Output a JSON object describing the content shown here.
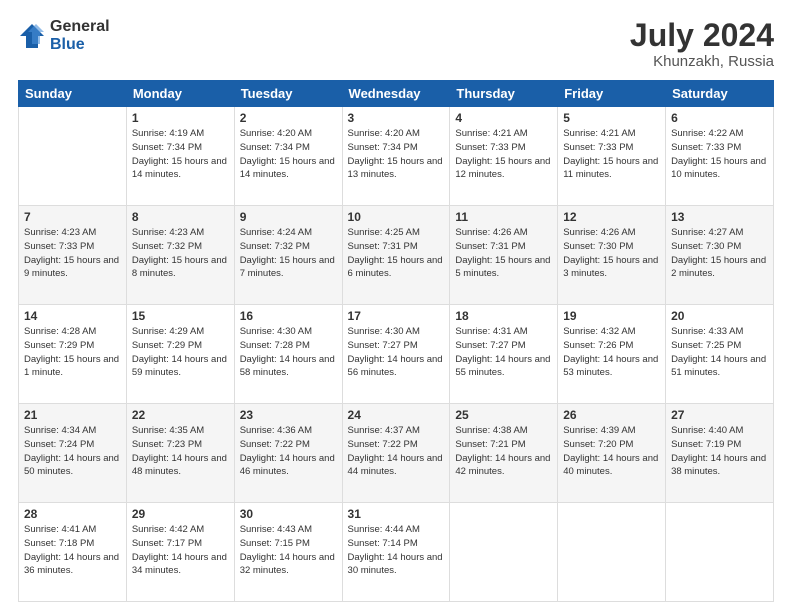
{
  "logo": {
    "general": "General",
    "blue": "Blue"
  },
  "title": {
    "month_year": "July 2024",
    "location": "Khunzakh, Russia"
  },
  "days_of_week": [
    "Sunday",
    "Monday",
    "Tuesday",
    "Wednesday",
    "Thursday",
    "Friday",
    "Saturday"
  ],
  "weeks": [
    [
      {
        "day": "",
        "sunrise": "",
        "sunset": "",
        "daylight": ""
      },
      {
        "day": "1",
        "sunrise": "Sunrise: 4:19 AM",
        "sunset": "Sunset: 7:34 PM",
        "daylight": "Daylight: 15 hours and 14 minutes."
      },
      {
        "day": "2",
        "sunrise": "Sunrise: 4:20 AM",
        "sunset": "Sunset: 7:34 PM",
        "daylight": "Daylight: 15 hours and 14 minutes."
      },
      {
        "day": "3",
        "sunrise": "Sunrise: 4:20 AM",
        "sunset": "Sunset: 7:34 PM",
        "daylight": "Daylight: 15 hours and 13 minutes."
      },
      {
        "day": "4",
        "sunrise": "Sunrise: 4:21 AM",
        "sunset": "Sunset: 7:33 PM",
        "daylight": "Daylight: 15 hours and 12 minutes."
      },
      {
        "day": "5",
        "sunrise": "Sunrise: 4:21 AM",
        "sunset": "Sunset: 7:33 PM",
        "daylight": "Daylight: 15 hours and 11 minutes."
      },
      {
        "day": "6",
        "sunrise": "Sunrise: 4:22 AM",
        "sunset": "Sunset: 7:33 PM",
        "daylight": "Daylight: 15 hours and 10 minutes."
      }
    ],
    [
      {
        "day": "7",
        "sunrise": "Sunrise: 4:23 AM",
        "sunset": "Sunset: 7:33 PM",
        "daylight": "Daylight: 15 hours and 9 minutes."
      },
      {
        "day": "8",
        "sunrise": "Sunrise: 4:23 AM",
        "sunset": "Sunset: 7:32 PM",
        "daylight": "Daylight: 15 hours and 8 minutes."
      },
      {
        "day": "9",
        "sunrise": "Sunrise: 4:24 AM",
        "sunset": "Sunset: 7:32 PM",
        "daylight": "Daylight: 15 hours and 7 minutes."
      },
      {
        "day": "10",
        "sunrise": "Sunrise: 4:25 AM",
        "sunset": "Sunset: 7:31 PM",
        "daylight": "Daylight: 15 hours and 6 minutes."
      },
      {
        "day": "11",
        "sunrise": "Sunrise: 4:26 AM",
        "sunset": "Sunset: 7:31 PM",
        "daylight": "Daylight: 15 hours and 5 minutes."
      },
      {
        "day": "12",
        "sunrise": "Sunrise: 4:26 AM",
        "sunset": "Sunset: 7:30 PM",
        "daylight": "Daylight: 15 hours and 3 minutes."
      },
      {
        "day": "13",
        "sunrise": "Sunrise: 4:27 AM",
        "sunset": "Sunset: 7:30 PM",
        "daylight": "Daylight: 15 hours and 2 minutes."
      }
    ],
    [
      {
        "day": "14",
        "sunrise": "Sunrise: 4:28 AM",
        "sunset": "Sunset: 7:29 PM",
        "daylight": "Daylight: 15 hours and 1 minute."
      },
      {
        "day": "15",
        "sunrise": "Sunrise: 4:29 AM",
        "sunset": "Sunset: 7:29 PM",
        "daylight": "Daylight: 14 hours and 59 minutes."
      },
      {
        "day": "16",
        "sunrise": "Sunrise: 4:30 AM",
        "sunset": "Sunset: 7:28 PM",
        "daylight": "Daylight: 14 hours and 58 minutes."
      },
      {
        "day": "17",
        "sunrise": "Sunrise: 4:30 AM",
        "sunset": "Sunset: 7:27 PM",
        "daylight": "Daylight: 14 hours and 56 minutes."
      },
      {
        "day": "18",
        "sunrise": "Sunrise: 4:31 AM",
        "sunset": "Sunset: 7:27 PM",
        "daylight": "Daylight: 14 hours and 55 minutes."
      },
      {
        "day": "19",
        "sunrise": "Sunrise: 4:32 AM",
        "sunset": "Sunset: 7:26 PM",
        "daylight": "Daylight: 14 hours and 53 minutes."
      },
      {
        "day": "20",
        "sunrise": "Sunrise: 4:33 AM",
        "sunset": "Sunset: 7:25 PM",
        "daylight": "Daylight: 14 hours and 51 minutes."
      }
    ],
    [
      {
        "day": "21",
        "sunrise": "Sunrise: 4:34 AM",
        "sunset": "Sunset: 7:24 PM",
        "daylight": "Daylight: 14 hours and 50 minutes."
      },
      {
        "day": "22",
        "sunrise": "Sunrise: 4:35 AM",
        "sunset": "Sunset: 7:23 PM",
        "daylight": "Daylight: 14 hours and 48 minutes."
      },
      {
        "day": "23",
        "sunrise": "Sunrise: 4:36 AM",
        "sunset": "Sunset: 7:22 PM",
        "daylight": "Daylight: 14 hours and 46 minutes."
      },
      {
        "day": "24",
        "sunrise": "Sunrise: 4:37 AM",
        "sunset": "Sunset: 7:22 PM",
        "daylight": "Daylight: 14 hours and 44 minutes."
      },
      {
        "day": "25",
        "sunrise": "Sunrise: 4:38 AM",
        "sunset": "Sunset: 7:21 PM",
        "daylight": "Daylight: 14 hours and 42 minutes."
      },
      {
        "day": "26",
        "sunrise": "Sunrise: 4:39 AM",
        "sunset": "Sunset: 7:20 PM",
        "daylight": "Daylight: 14 hours and 40 minutes."
      },
      {
        "day": "27",
        "sunrise": "Sunrise: 4:40 AM",
        "sunset": "Sunset: 7:19 PM",
        "daylight": "Daylight: 14 hours and 38 minutes."
      }
    ],
    [
      {
        "day": "28",
        "sunrise": "Sunrise: 4:41 AM",
        "sunset": "Sunset: 7:18 PM",
        "daylight": "Daylight: 14 hours and 36 minutes."
      },
      {
        "day": "29",
        "sunrise": "Sunrise: 4:42 AM",
        "sunset": "Sunset: 7:17 PM",
        "daylight": "Daylight: 14 hours and 34 minutes."
      },
      {
        "day": "30",
        "sunrise": "Sunrise: 4:43 AM",
        "sunset": "Sunset: 7:15 PM",
        "daylight": "Daylight: 14 hours and 32 minutes."
      },
      {
        "day": "31",
        "sunrise": "Sunrise: 4:44 AM",
        "sunset": "Sunset: 7:14 PM",
        "daylight": "Daylight: 14 hours and 30 minutes."
      },
      {
        "day": "",
        "sunrise": "",
        "sunset": "",
        "daylight": ""
      },
      {
        "day": "",
        "sunrise": "",
        "sunset": "",
        "daylight": ""
      },
      {
        "day": "",
        "sunrise": "",
        "sunset": "",
        "daylight": ""
      }
    ]
  ]
}
